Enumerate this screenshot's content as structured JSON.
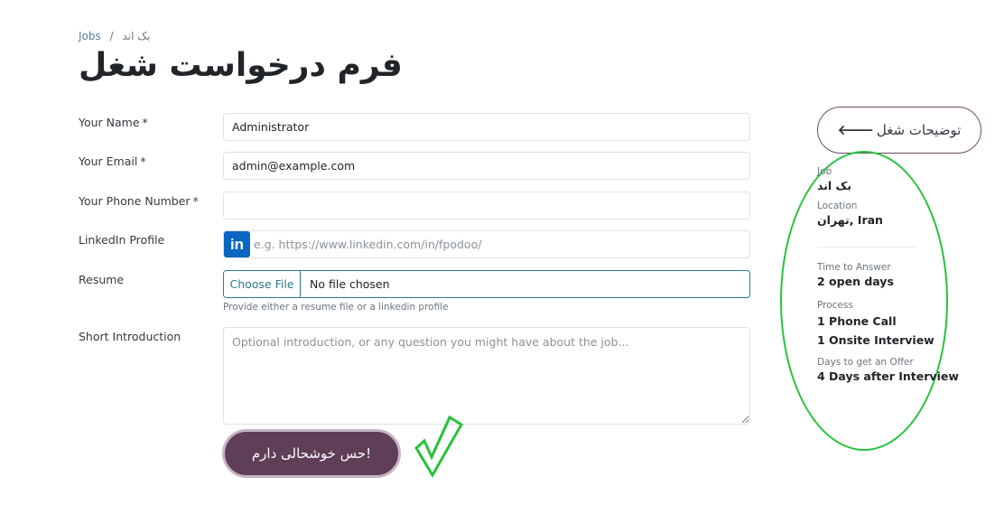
{
  "breadcrumb": {
    "root": "Jobs",
    "separator": "/",
    "current": "بک اند"
  },
  "page_title": "فرم درخواست شغل",
  "form": {
    "name": {
      "label": "Your Name",
      "required_mark": "*",
      "value": "Administrator"
    },
    "email": {
      "label": "Your Email",
      "required_mark": "*",
      "value": "admin@example.com"
    },
    "phone": {
      "label": "Your Phone Number",
      "required_mark": "*",
      "value": ""
    },
    "linkedin": {
      "label": "LinkedIn Profile",
      "icon_text": "in",
      "placeholder": "e.g. https://www.linkedin.com/in/fpodoo/"
    },
    "resume": {
      "label": "Resume",
      "button_label": "Choose File",
      "status": "No file chosen",
      "helper": "Provide either a resume file or a linkedin profile"
    },
    "intro": {
      "label": "Short Introduction",
      "placeholder": "Optional introduction, or any question you might have about the job..."
    },
    "submit_label": "!حس خوشحالی دارم"
  },
  "sidebar": {
    "back_label": "توضیحات شغل",
    "back_arrow": "🡐",
    "job_label": "Job",
    "job_value": "بک اند",
    "location_label": "Location",
    "location_value": "تهران, Iran",
    "time_label": "Time to Answer",
    "time_value": "2 open days",
    "process_label": "Process",
    "process_steps": [
      "1 Phone Call",
      "1 Onsite Interview"
    ],
    "offer_label": "Days to get an Offer",
    "offer_value": "4 Days after Interview"
  },
  "colors": {
    "primary": "#5f3e58",
    "accent_outline": "#26c23b",
    "linkedin": "#0a66c2",
    "file_border": "#2f7a8a"
  },
  "icons": {
    "linkedin": "linkedin-icon",
    "check": "check-icon",
    "arrow": "arrow-left-icon"
  }
}
